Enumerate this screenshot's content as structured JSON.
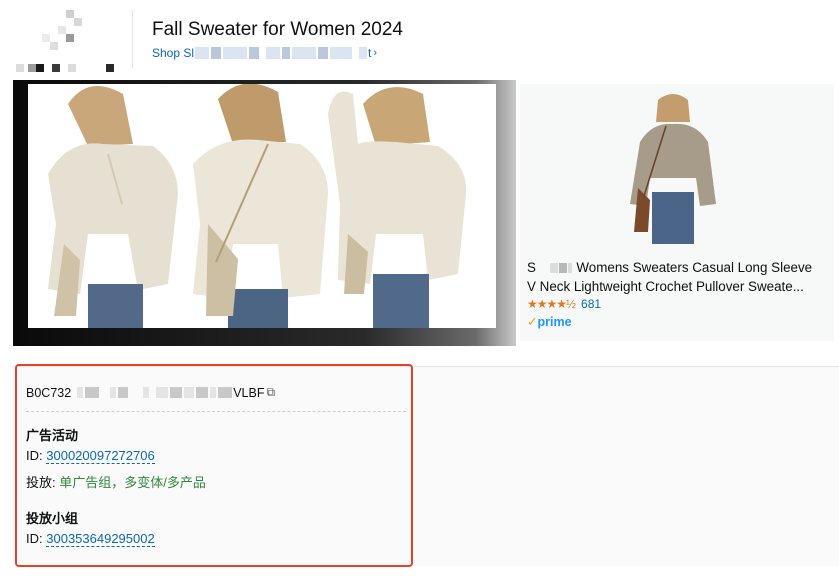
{
  "header": {
    "headline": "Fall Sweater for Women 2024",
    "shop_link_prefix": "Shop Sl",
    "shop_link_suffix": "t",
    "shop_link_chevron": "›"
  },
  "product": {
    "title_line1_prefix": "S",
    "title_line1_rest": "Womens Sweaters Casual Long Sleeve",
    "title_line2": "V Neck Lightweight Crochet Pullover Sweate...",
    "rating_stars": "★★★★½",
    "rating": 4.5,
    "rating_count": "681",
    "prime_check": "✓",
    "prime_label": "prime"
  },
  "details": {
    "asin_prefix": "B0C732",
    "asin_suffix": "VLBF",
    "copy_icon": "⧉",
    "campaign": {
      "title": "广告活动",
      "id_label": "ID:",
      "id_value": "300020097272706",
      "targeting_label": "投放:",
      "targeting_value": "单广告组，多变体/多产品"
    },
    "ad_group": {
      "title": "投放小组",
      "id_label": "ID:",
      "id_value": "300353649295002"
    }
  },
  "colors": {
    "link": "#0a66b7",
    "highlight_border": "#e0422b",
    "targeting_value": "#2e8b3a",
    "stars": "#de7921",
    "prime": "#1a98ff"
  },
  "icons": {
    "brand_logo": "pixelated-logo",
    "copy": "copy-icon",
    "chevron": "chevron-right-icon"
  }
}
